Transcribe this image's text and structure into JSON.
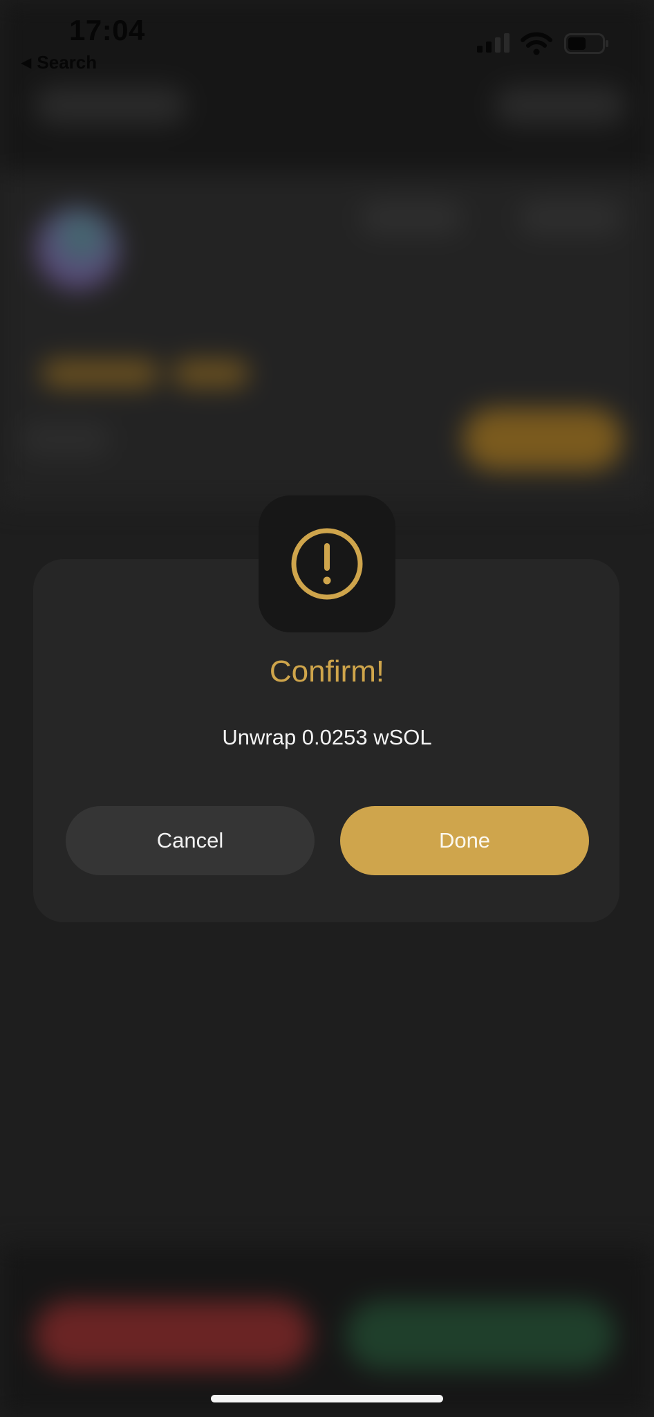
{
  "status_bar": {
    "time": "17:04",
    "back_label": "Search"
  },
  "dialog": {
    "icon": "alert-circle-icon",
    "title": "Confirm!",
    "message": "Unwrap 0.0253 wSOL",
    "cancel_label": "Cancel",
    "done_label": "Done"
  },
  "colors": {
    "accent": "#cfa54c",
    "dialog_bg": "#262626",
    "badge_bg": "#171717",
    "cancel_bg": "#353535",
    "screen_bg": "#1e1e1e"
  }
}
